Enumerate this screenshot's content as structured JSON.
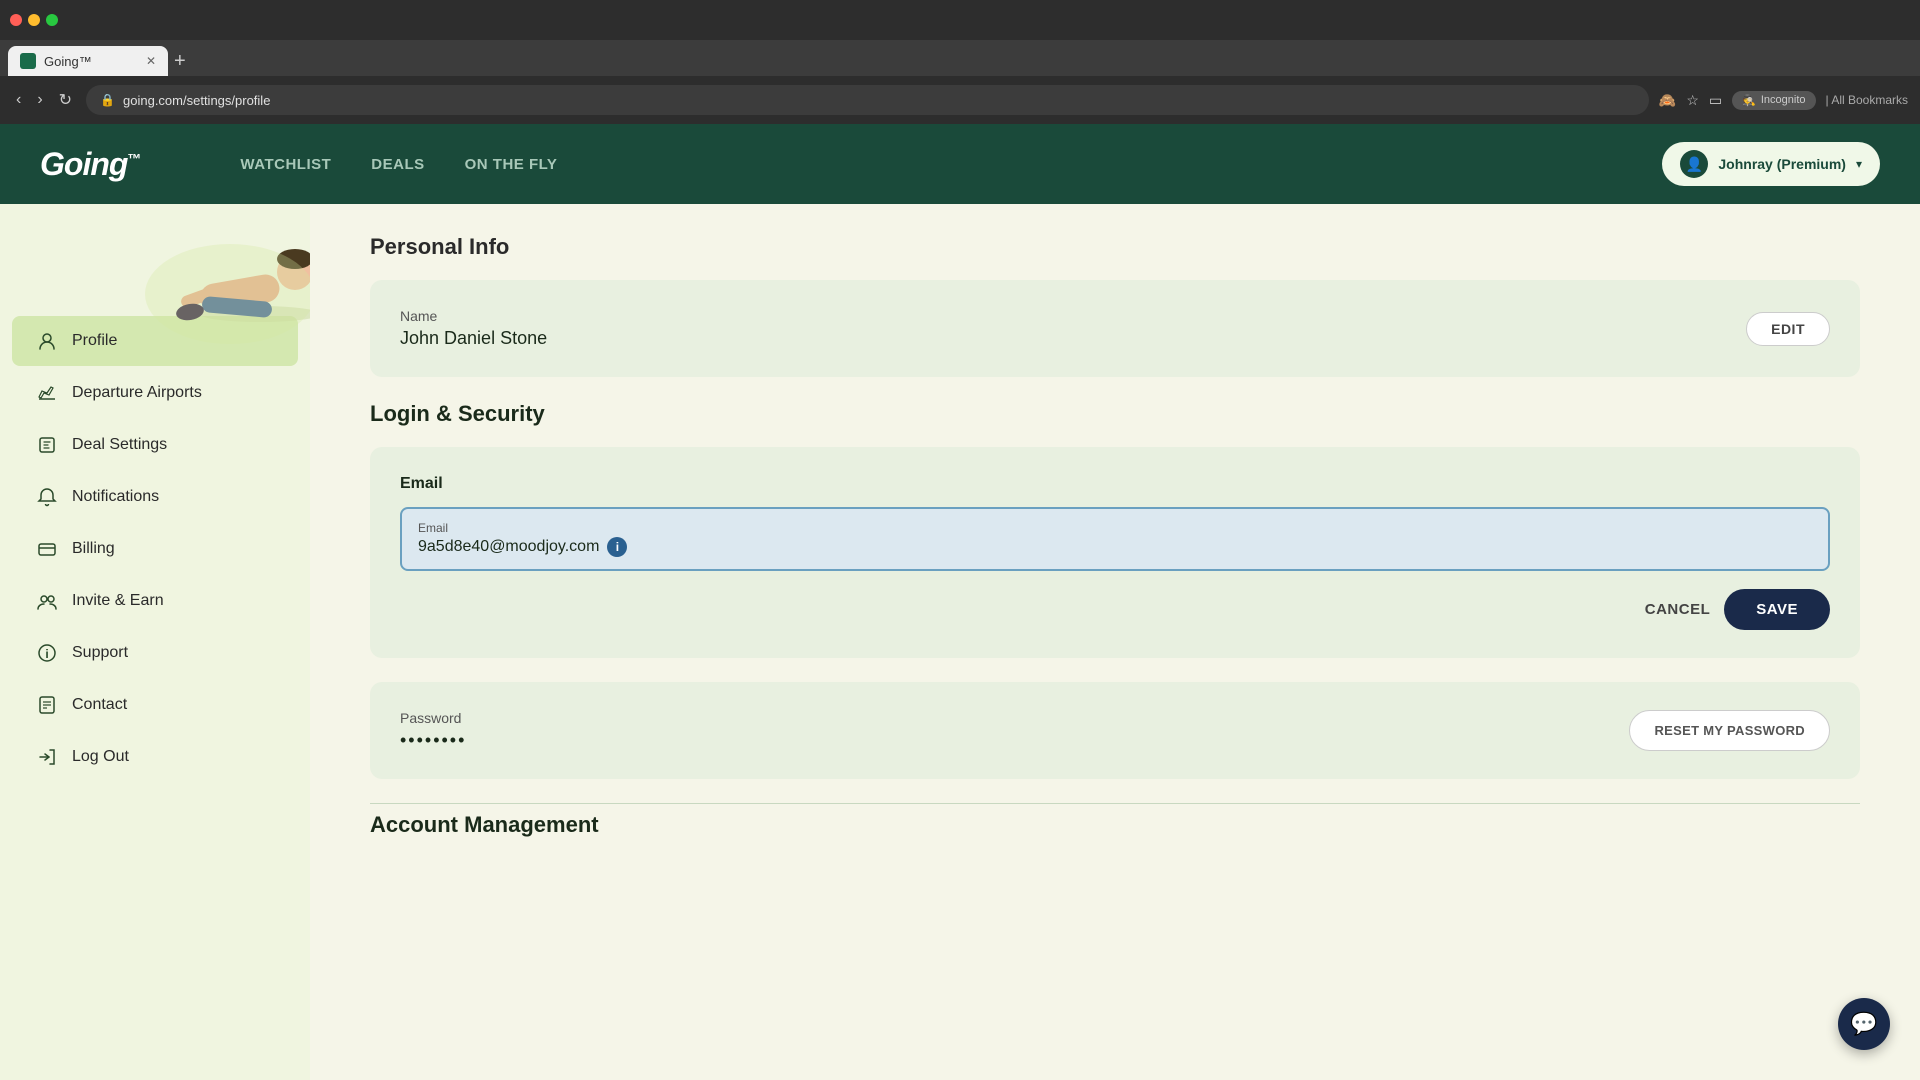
{
  "browser": {
    "tab_title": "Going™",
    "url": "going.com/settings/profile",
    "new_tab_label": "+",
    "incognito_label": "Incognito",
    "bookmarks_label": "All Bookmarks"
  },
  "header": {
    "logo": "Going",
    "logo_tm": "™",
    "nav": {
      "watchlist": "WATCHLIST",
      "deals": "DEALS",
      "on_the_fly": "ON THE FLY"
    },
    "user": {
      "name": "Johnray (Premium)",
      "chevron": "▾"
    }
  },
  "sidebar": {
    "items": [
      {
        "id": "profile",
        "label": "Profile",
        "icon": "👤",
        "active": true
      },
      {
        "id": "departure-airports",
        "label": "Departure Airports",
        "icon": "✈"
      },
      {
        "id": "deal-settings",
        "label": "Deal Settings",
        "icon": "🏷"
      },
      {
        "id": "notifications",
        "label": "Notifications",
        "icon": "🔔"
      },
      {
        "id": "billing",
        "label": "Billing",
        "icon": "💳"
      },
      {
        "id": "invite-earn",
        "label": "Invite & Earn",
        "icon": "👥"
      },
      {
        "id": "support",
        "label": "Support",
        "icon": "ℹ"
      },
      {
        "id": "contact",
        "label": "Contact",
        "icon": "📋"
      },
      {
        "id": "log-out",
        "label": "Log Out",
        "icon": "↩"
      }
    ]
  },
  "content": {
    "personal_info": {
      "section_title": "Personal Info",
      "name_label": "Name",
      "name_value": "John Daniel Stone",
      "edit_button": "EDIT"
    },
    "login_security": {
      "section_title": "Login & Security",
      "email": {
        "section_label": "Email",
        "input_label": "Email",
        "input_value": "9a5d8e40@moodjoy.com",
        "cancel_button": "CANCEL",
        "save_button": "SAVE"
      },
      "password": {
        "label": "Password",
        "dots": "••••••••",
        "reset_button": "RESET MY PASSWORD"
      }
    },
    "account_management": {
      "section_title": "Account Management"
    }
  },
  "chat": {
    "icon": "💬"
  }
}
